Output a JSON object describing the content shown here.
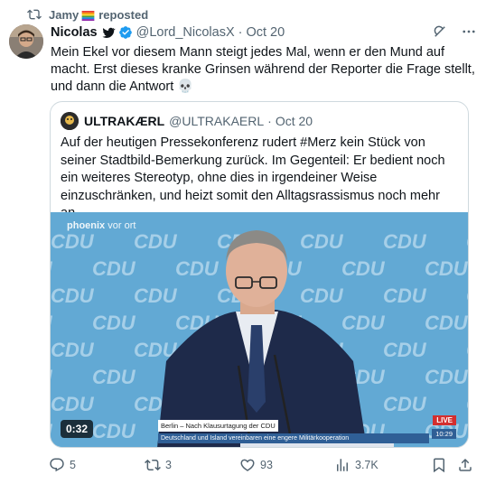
{
  "repost": {
    "user": "Jamy",
    "label": "reposted",
    "icon": "repost-icon"
  },
  "tweet": {
    "author_name": "Nicolas",
    "handle": "@Lord_NicolasX",
    "separator": "·",
    "time": "Oct 20",
    "text": "Mein Ekel vor diesem Mann steigt jedes Mal, wenn er den Mund auf macht. Erst dieses kranke Grinsen während der Reporter die Frage stellt, und dann die Antwort 💀"
  },
  "quote": {
    "author_name": "ULTRAKÆRL",
    "handle": "@ULTRAKAERL",
    "separator": "·",
    "time": "Oct 20",
    "text": "Auf der heutigen Pressekonferenz rudert #Merz kein Stück von seiner Stadtbild-Bemerkung zurück. Im Gegenteil: Er bedient noch ein weiteres Stereotyp, ohne dies in irgendeiner Weise einzuschränken, und heizt somit den Alltagsrassismus noch mehr an.",
    "video": {
      "channel_logo": "phoenix",
      "channel_sub": "vor ort",
      "backdrop_text": "CDU",
      "duration": "0:32",
      "ticker_title": "Berlin – Nach Klausurtagung der CDU",
      "ticker_sub": "Deutschland und Island vereinbaren eine engere Militärkooperation",
      "live_label": "LIVE",
      "live_time": "10:29"
    }
  },
  "actions": {
    "replies": "5",
    "reposts": "3",
    "likes": "93",
    "views": "3.7K"
  },
  "colors": {
    "muted": "#536471",
    "accent": "#1d9bf0",
    "border": "#cfd9de",
    "cdu_blue": "#62a9d4"
  }
}
